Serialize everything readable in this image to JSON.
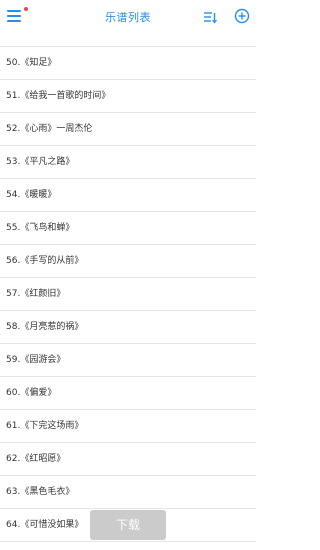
{
  "header": {
    "title": "乐谱列表",
    "menu_icon": "hamburger-menu-icon",
    "sort_icon": "sort-list-icon",
    "add_icon": "add-circle-icon",
    "accent_color": "#2a8ee8",
    "badge_color": "#e84a4a"
  },
  "list": {
    "items": [
      "50.《知足》",
      "51.《给我一首歌的时间》",
      "52.《心雨》一周杰伦",
      "53.《平凡之路》",
      "54.《暖暖》",
      "55.《飞鸟和蝉》",
      "56.《手写的从前》",
      "57.《红颜旧》",
      "58.《月亮惹的祸》",
      "59.《园游会》",
      "60.《偏爱》",
      "61.《下完这场雨》",
      "62.《红昭愿》",
      "63.《黑色毛衣》",
      "64.《可惜没如果》"
    ]
  },
  "download_button": {
    "label": "下载"
  }
}
